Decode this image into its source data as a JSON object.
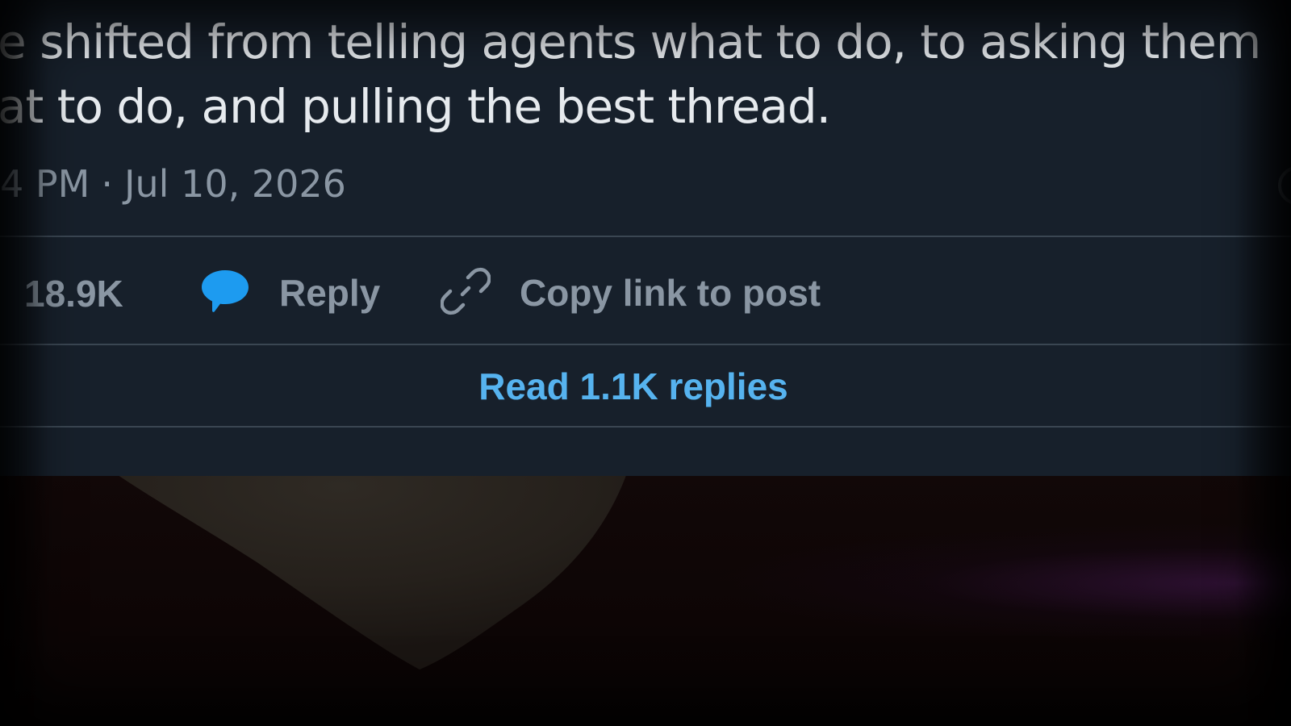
{
  "post": {
    "text_line_1": "e shifted from telling agents what to do, to asking them",
    "text_line_2": "at to do, and pulling the best thread.",
    "time": "4 PM",
    "separator": "·",
    "date": "Jul 10, 2026"
  },
  "actions": {
    "like_count": "18.9K",
    "reply_label": "Reply",
    "copy_link_label": "Copy link to post"
  },
  "read_replies": {
    "label": "Read 1.1K replies"
  },
  "icons": {
    "reply": "speech-bubble-icon",
    "copy_link": "link-icon"
  },
  "colors": {
    "card_background": "#17202b",
    "post_text": "#e6eaee",
    "muted_text": "#8a96a3",
    "accent_blue": "#1d9bf0",
    "link_blue": "#56b3ef",
    "divider": "#3a4652"
  }
}
